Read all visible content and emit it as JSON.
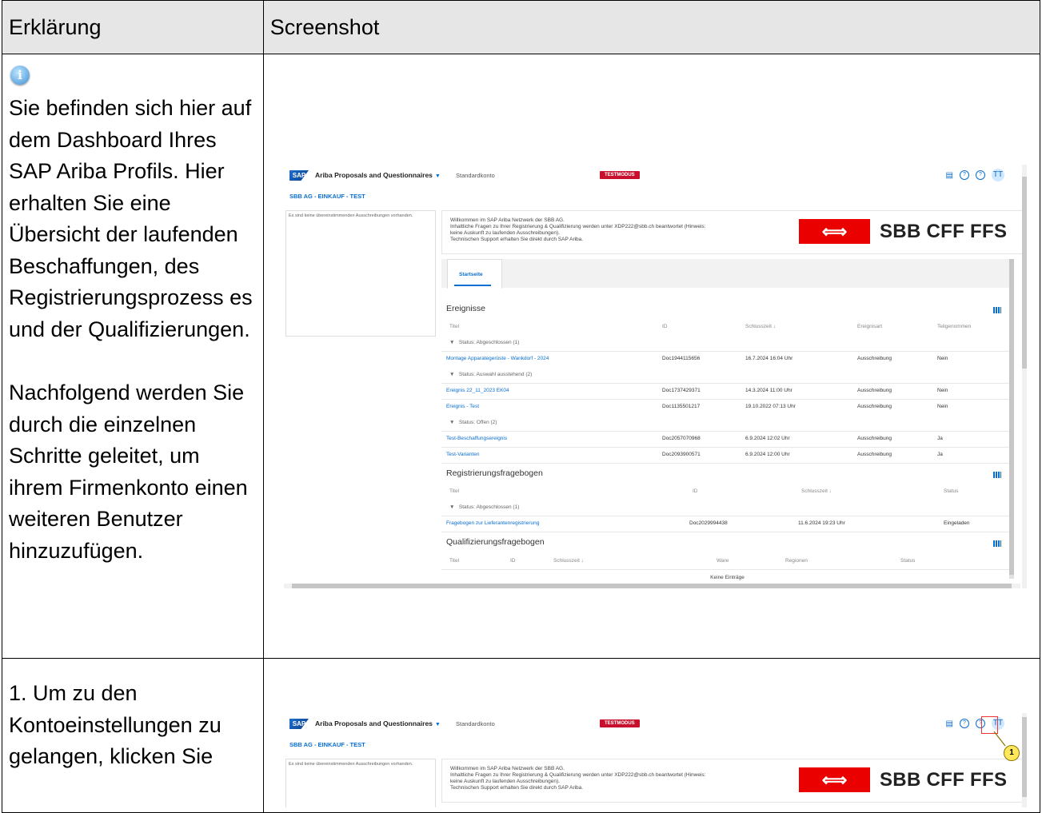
{
  "table": {
    "header_left": "Erklärung",
    "header_right": "Screenshot"
  },
  "row1": {
    "text_p1_a": "Sie befinden sich hier auf dem ",
    "text_p1_b": "Dashboard Ihres SAP Ariba Profils",
    "text_p1_c": ". Hier erhalten Sie eine Übersicht der laufenden Beschaffungen, des Registrierungsprozess es und der Qualifizierungen.",
    "text_p2_a": "Nachfolgend werden Sie durch die einzelnen Schritte geleitet, um ihrem Firmenkonto einen ",
    "text_p2_b": "weiteren Benutzer hinzuzufügen",
    "text_p2_c": "."
  },
  "row2": {
    "text_a": "1. Um zu den ",
    "text_b": "Kontoeinstellungen",
    "text_c": " zu gelangen, klicken Sie"
  },
  "ariba": {
    "sap_logo": "SAP",
    "app_name": "Ariba Proposals and Questionnaires",
    "account": "Standardkonto",
    "testmodus": "TESTMODUS",
    "avatar": "TT",
    "org": "SBB AG - EINKAUF - TEST",
    "left_note": "Es sind keine übereinstimmenden Ausschreibungen vorhanden.",
    "banner_line1": "Willkommen im SAP Ariba Netzwerk der SBB AG.",
    "banner_line2": "Inhaltliche Fragen zu Ihrer Registrierung & Qualifizierung werden unter XDP222@sbb.ch beantwortet (Hinweis:",
    "banner_line3": "keine Auskunft zu laufenden Ausschreibungen).",
    "banner_line4": "Technischen Support erhalten Sie direkt durch SAP Ariba.",
    "sbb_symbol": "⟺",
    "sbb_word": "SBB CFF FFS",
    "tab": "Startseite",
    "events": {
      "title": "Ereignisse",
      "headers": [
        "Titel",
        "ID",
        "Schlusszeit ↓",
        "Ereignisart",
        "Teilgenommen"
      ],
      "group1": "Status: Abgeschlossen  (1)",
      "row1": [
        "Montage Apparategerüste - Wankdorf - 2024",
        "Doc1944115656",
        "16.7.2024 16:04 Uhr",
        "Ausschreibung",
        "Nein"
      ],
      "group2": "Status: Auswahl ausstehend  (2)",
      "row2": [
        "Ereignis 22_11_2023 EK04",
        "Doc1737429371",
        "14.3.2024 11:00 Uhr",
        "Ausschreibung",
        "Nein"
      ],
      "row3": [
        "Ereignis - Test",
        "Doc1135501217",
        "19.10.2022 07:13 Uhr",
        "Ausschreibung",
        "Nein"
      ],
      "group3": "Status: Offen  (2)",
      "row4": [
        "Test-Beschaffungsereignis",
        "Doc2057070968",
        "6.9.2024 12:02 Uhr",
        "Ausschreibung",
        "Ja"
      ],
      "row5": [
        "Test-Varianten",
        "Doc2093900571",
        "6.9.2024 12:00 Uhr",
        "Ausschreibung",
        "Ja"
      ]
    },
    "reg": {
      "title": "Registrierungsfragebogen",
      "headers": [
        "Titel",
        "ID",
        "Schlusszeit ↓",
        "Status"
      ],
      "group1": "Status: Abgeschlossen  (1)",
      "row1": [
        "Fragebogen zur Lieferantenregistrierung",
        "Doc2029994438",
        "11.6.2024 19:23 Uhr",
        "Eingeladen"
      ]
    },
    "qual": {
      "title": "Qualifizierungsfragebogen",
      "headers": [
        "Titel",
        "ID",
        "Schlusszeit ↓",
        "Ware",
        "Regionen",
        "Status"
      ],
      "empty": "Keine Einträge"
    },
    "marker": "1"
  }
}
